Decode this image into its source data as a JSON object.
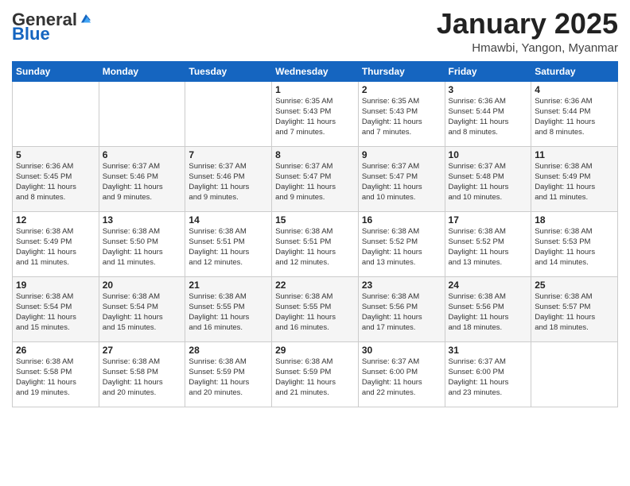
{
  "header": {
    "logo": {
      "general": "General",
      "blue": "Blue"
    },
    "title": "January 2025",
    "subtitle": "Hmawbi, Yangon, Myanmar"
  },
  "calendar": {
    "days_of_week": [
      "Sunday",
      "Monday",
      "Tuesday",
      "Wednesday",
      "Thursday",
      "Friday",
      "Saturday"
    ],
    "weeks": [
      [
        {
          "day": "",
          "info": ""
        },
        {
          "day": "",
          "info": ""
        },
        {
          "day": "",
          "info": ""
        },
        {
          "day": "1",
          "info": "Sunrise: 6:35 AM\nSunset: 5:43 PM\nDaylight: 11 hours\nand 7 minutes."
        },
        {
          "day": "2",
          "info": "Sunrise: 6:35 AM\nSunset: 5:43 PM\nDaylight: 11 hours\nand 7 minutes."
        },
        {
          "day": "3",
          "info": "Sunrise: 6:36 AM\nSunset: 5:44 PM\nDaylight: 11 hours\nand 8 minutes."
        },
        {
          "day": "4",
          "info": "Sunrise: 6:36 AM\nSunset: 5:44 PM\nDaylight: 11 hours\nand 8 minutes."
        }
      ],
      [
        {
          "day": "5",
          "info": "Sunrise: 6:36 AM\nSunset: 5:45 PM\nDaylight: 11 hours\nand 8 minutes."
        },
        {
          "day": "6",
          "info": "Sunrise: 6:37 AM\nSunset: 5:46 PM\nDaylight: 11 hours\nand 9 minutes."
        },
        {
          "day": "7",
          "info": "Sunrise: 6:37 AM\nSunset: 5:46 PM\nDaylight: 11 hours\nand 9 minutes."
        },
        {
          "day": "8",
          "info": "Sunrise: 6:37 AM\nSunset: 5:47 PM\nDaylight: 11 hours\nand 9 minutes."
        },
        {
          "day": "9",
          "info": "Sunrise: 6:37 AM\nSunset: 5:47 PM\nDaylight: 11 hours\nand 10 minutes."
        },
        {
          "day": "10",
          "info": "Sunrise: 6:37 AM\nSunset: 5:48 PM\nDaylight: 11 hours\nand 10 minutes."
        },
        {
          "day": "11",
          "info": "Sunrise: 6:38 AM\nSunset: 5:49 PM\nDaylight: 11 hours\nand 11 minutes."
        }
      ],
      [
        {
          "day": "12",
          "info": "Sunrise: 6:38 AM\nSunset: 5:49 PM\nDaylight: 11 hours\nand 11 minutes."
        },
        {
          "day": "13",
          "info": "Sunrise: 6:38 AM\nSunset: 5:50 PM\nDaylight: 11 hours\nand 11 minutes."
        },
        {
          "day": "14",
          "info": "Sunrise: 6:38 AM\nSunset: 5:51 PM\nDaylight: 11 hours\nand 12 minutes."
        },
        {
          "day": "15",
          "info": "Sunrise: 6:38 AM\nSunset: 5:51 PM\nDaylight: 11 hours\nand 12 minutes."
        },
        {
          "day": "16",
          "info": "Sunrise: 6:38 AM\nSunset: 5:52 PM\nDaylight: 11 hours\nand 13 minutes."
        },
        {
          "day": "17",
          "info": "Sunrise: 6:38 AM\nSunset: 5:52 PM\nDaylight: 11 hours\nand 13 minutes."
        },
        {
          "day": "18",
          "info": "Sunrise: 6:38 AM\nSunset: 5:53 PM\nDaylight: 11 hours\nand 14 minutes."
        }
      ],
      [
        {
          "day": "19",
          "info": "Sunrise: 6:38 AM\nSunset: 5:54 PM\nDaylight: 11 hours\nand 15 minutes."
        },
        {
          "day": "20",
          "info": "Sunrise: 6:38 AM\nSunset: 5:54 PM\nDaylight: 11 hours\nand 15 minutes."
        },
        {
          "day": "21",
          "info": "Sunrise: 6:38 AM\nSunset: 5:55 PM\nDaylight: 11 hours\nand 16 minutes."
        },
        {
          "day": "22",
          "info": "Sunrise: 6:38 AM\nSunset: 5:55 PM\nDaylight: 11 hours\nand 16 minutes."
        },
        {
          "day": "23",
          "info": "Sunrise: 6:38 AM\nSunset: 5:56 PM\nDaylight: 11 hours\nand 17 minutes."
        },
        {
          "day": "24",
          "info": "Sunrise: 6:38 AM\nSunset: 5:56 PM\nDaylight: 11 hours\nand 18 minutes."
        },
        {
          "day": "25",
          "info": "Sunrise: 6:38 AM\nSunset: 5:57 PM\nDaylight: 11 hours\nand 18 minutes."
        }
      ],
      [
        {
          "day": "26",
          "info": "Sunrise: 6:38 AM\nSunset: 5:58 PM\nDaylight: 11 hours\nand 19 minutes."
        },
        {
          "day": "27",
          "info": "Sunrise: 6:38 AM\nSunset: 5:58 PM\nDaylight: 11 hours\nand 20 minutes."
        },
        {
          "day": "28",
          "info": "Sunrise: 6:38 AM\nSunset: 5:59 PM\nDaylight: 11 hours\nand 20 minutes."
        },
        {
          "day": "29",
          "info": "Sunrise: 6:38 AM\nSunset: 5:59 PM\nDaylight: 11 hours\nand 21 minutes."
        },
        {
          "day": "30",
          "info": "Sunrise: 6:37 AM\nSunset: 6:00 PM\nDaylight: 11 hours\nand 22 minutes."
        },
        {
          "day": "31",
          "info": "Sunrise: 6:37 AM\nSunset: 6:00 PM\nDaylight: 11 hours\nand 23 minutes."
        },
        {
          "day": "",
          "info": ""
        }
      ]
    ]
  }
}
